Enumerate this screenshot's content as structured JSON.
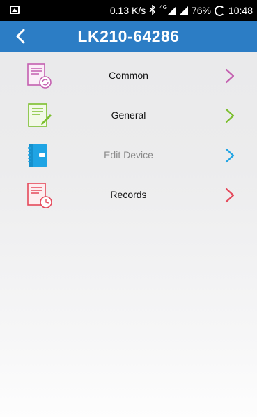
{
  "status_bar": {
    "speed": "0.13 K/s",
    "network_tag": "4G",
    "battery": "76%",
    "time": "10:48",
    "icons": [
      "image-icon",
      "bluetooth-icon",
      "signal-icon",
      "battery-saver-icon"
    ]
  },
  "header": {
    "title": "LK210-64286",
    "back_icon": "chevron-left-icon",
    "background": "#2c7dc5"
  },
  "menu": {
    "items": [
      {
        "label": "Common",
        "icon": "document-sync-icon",
        "color": "#c45fb0",
        "muted": false
      },
      {
        "label": "General",
        "icon": "document-edit-icon",
        "color": "#7cbf2e",
        "muted": false
      },
      {
        "label": "Edit Device",
        "icon": "notebook-icon",
        "color": "#1fa4e4",
        "muted": true
      },
      {
        "label": "Records",
        "icon": "document-clock-icon",
        "color": "#e5495b",
        "muted": false
      }
    ]
  }
}
